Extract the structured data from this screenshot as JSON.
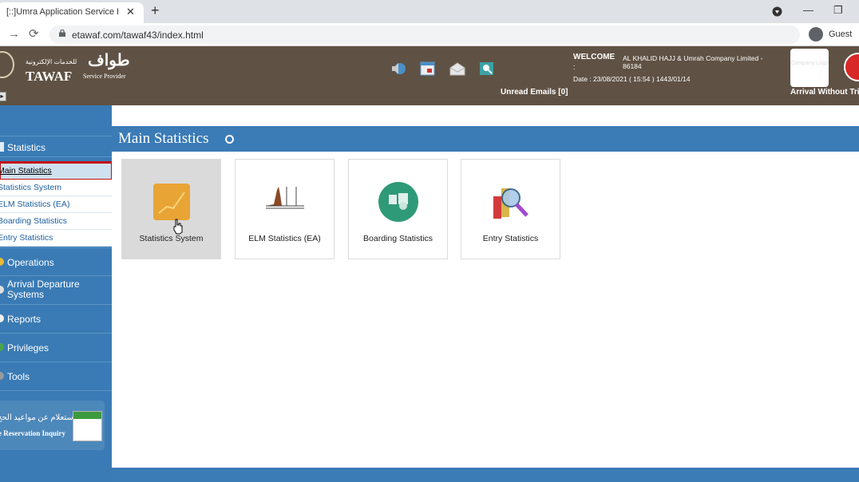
{
  "browser": {
    "tab_title": "[::]Umra Application Service Prov",
    "url": "etawaf.com/tawaf43/index.html",
    "guest_label": "Guest"
  },
  "header": {
    "logo_ar": "طواف",
    "logo_ar_small": "للخدمات الإلكترونية",
    "logo_en": "TAWAF",
    "logo_sub": "Service Provider",
    "welcome": "WELCOME",
    "colon": ":",
    "company": "AL KHALID HAJJ & Umrah Company Limited - 86184",
    "date": "Date : 23/08/2021 ( 15:54 ) 1443/01/14",
    "unread": "Unread Emails [0]",
    "company_logo": "Company Logo",
    "arrival_wo": "Arrival Without Tri"
  },
  "sidebar": {
    "statistics": "Statistics",
    "sub_items": [
      "Main Statistics",
      "Statistics System",
      "ELM Statistics (EA)",
      "Boarding Statistics",
      "Entry Statistics"
    ],
    "operations": "Operations",
    "arrival": "Arrival Departure Systems",
    "reports": "Reports",
    "privileges": "Privileges",
    "tools": "Tools",
    "res_ar": "إستعلام عن مواعيد الحج",
    "res_en": "e Reservation Inquiry"
  },
  "main": {
    "title": "Main Statistics",
    "tiles": [
      "Statistics System",
      "ELM Statistics (EA)",
      "Boarding Statistics",
      "Entry Statistics"
    ]
  },
  "colors": {
    "accent": "#3b7bb6",
    "header": "#5f5244",
    "highlight": "#c40f14"
  }
}
